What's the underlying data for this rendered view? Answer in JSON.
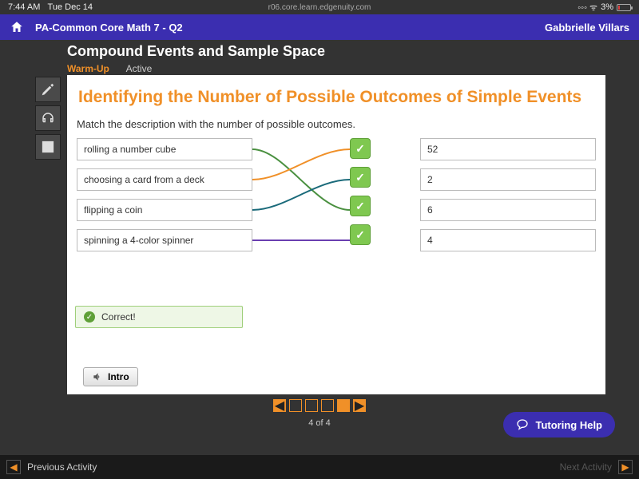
{
  "statusbar": {
    "time": "7:44 AM",
    "date": "Tue Dec 14",
    "url": "r06.core.learn.edgenuity.com",
    "battery": "3%"
  },
  "header": {
    "course": "PA-Common Core Math 7 - Q2",
    "user": "Gabbrielle Villars"
  },
  "lesson": {
    "title": "Compound Events and Sample Space",
    "section": "Warm-Up",
    "state": "Active"
  },
  "content": {
    "title": "Identifying the Number of Possible Outcomes of Simple Events",
    "instruction": "Match the description with the number of possible outcomes.",
    "left": [
      "rolling a number cube",
      "choosing a card from a deck",
      "flipping a coin",
      "spinning a 4-color spinner"
    ],
    "right": [
      "52",
      "2",
      "6",
      "4"
    ],
    "feedback": "Correct!",
    "intro_label": "Intro"
  },
  "pager": {
    "current": 4,
    "total": 4,
    "label": "4 of 4"
  },
  "tutoring": "Tutoring Help",
  "footer": {
    "prev": "Previous Activity",
    "next": "Next Activity"
  }
}
